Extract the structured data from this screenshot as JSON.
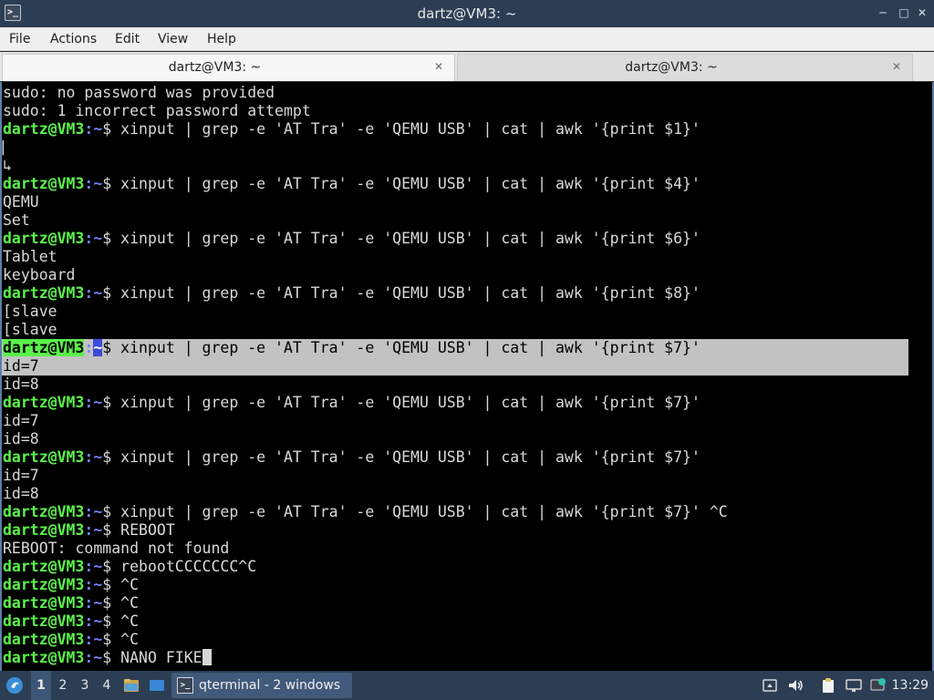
{
  "window": {
    "title": "dartz@VM3: ~",
    "app_icon": "terminal-icon",
    "buttons": {
      "minimize": "─",
      "maximize": "□",
      "close": "✕"
    }
  },
  "menu": [
    "File",
    "Actions",
    "Edit",
    "View",
    "Help"
  ],
  "tabs": [
    {
      "label": "dartz@VM3: ~",
      "close": "✕",
      "active": true
    },
    {
      "label": "dartz@VM3: ~",
      "close": "✕",
      "active": false
    }
  ],
  "terminal": {
    "prompt": {
      "user": "dartz@VM3",
      "sep": ":",
      "path": "~",
      "sign": "$ "
    },
    "lines": [
      {
        "text": "sudo: no password was provided"
      },
      {
        "text": "sudo: 1 incorrect password attempt"
      },
      {
        "cmd": "xinput | grep -e 'AT Tra' -e 'QEMU USB' | cat | awk '{print $1}'"
      },
      {
        "text": "⎸"
      },
      {
        "text": "↳"
      },
      {
        "cmd": "xinput | grep -e 'AT Tra' -e 'QEMU USB' | cat | awk '{print $4}'"
      },
      {
        "text": "QEMU"
      },
      {
        "text": "Set"
      },
      {
        "cmd": "xinput | grep -e 'AT Tra' -e 'QEMU USB' | cat | awk '{print $6}'"
      },
      {
        "text": "Tablet"
      },
      {
        "text": "keyboard"
      },
      {
        "cmd": "xinput | grep -e 'AT Tra' -e 'QEMU USB' | cat | awk '{print $8}'"
      },
      {
        "text": "[slave"
      },
      {
        "text": "[slave"
      },
      {
        "cmd": "xinput | grep -e 'AT Tra' -e 'QEMU USB' | cat | awk '{print $7}'",
        "selected": true
      },
      {
        "text": "id=7",
        "selected": true
      },
      {
        "text": "id=8"
      },
      {
        "cmd": "xinput | grep -e 'AT Tra' -e 'QEMU USB' | cat | awk '{print $7}'"
      },
      {
        "text": "id=7"
      },
      {
        "text": "id=8"
      },
      {
        "cmd": "xinput | grep -e 'AT Tra' -e 'QEMU USB' | cat | awk '{print $7}'"
      },
      {
        "text": "id=7"
      },
      {
        "text": "id=8"
      },
      {
        "cmd": "xinput | grep -e 'AT Tra' -e 'QEMU USB' | cat | awk '{print $7}' ^C"
      },
      {
        "cmd": "REBOOT"
      },
      {
        "text": "REBOOT: command not found"
      },
      {
        "cmd": "rebootCCCCCCC^C"
      },
      {
        "cmd": "^C"
      },
      {
        "cmd": "^C"
      },
      {
        "cmd": "^C"
      },
      {
        "cmd": "^C"
      },
      {
        "cmd": "NANO FIKE",
        "cursor": true
      }
    ]
  },
  "taskbar": {
    "start_icon": "lxqt-menu-icon",
    "workspaces": [
      "1",
      "2",
      "3",
      "4"
    ],
    "active_workspace": "1",
    "quicklaunch": [
      "file-manager-icon",
      "desktop-icon"
    ],
    "task": {
      "icon": "terminal-icon",
      "label": "qterminal - 2 windows"
    },
    "tray": [
      "removable-media-icon",
      "volume-icon",
      "clipboard-icon",
      "network-icon",
      "update-icon"
    ],
    "clock": "13:29"
  }
}
